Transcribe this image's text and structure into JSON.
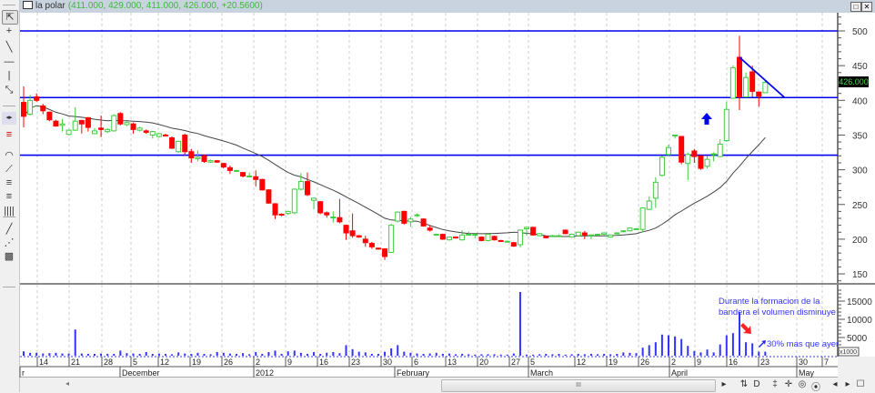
{
  "window": {
    "symbol": "la polar",
    "ohlc_readout": "(411.000, 429.000, 411.000, 426.000, +20.5600)",
    "last_price_label": "426.000"
  },
  "toolbar": {
    "icons": [
      "cursor-arrow",
      "crosshair",
      "trendline",
      "horizontal-line",
      "vertical-line",
      "channel",
      "scroll-arrows",
      "indicators",
      "arcs",
      "fan",
      "fibonacci-p",
      "fibonacci-r",
      "time-zones",
      "line",
      "speed-lines",
      "grid-pattern"
    ]
  },
  "bottom_toolbar": {
    "scroll_thumb_label": "III",
    "buttons": [
      "▸",
      "⇅",
      "D",
      "‡",
      "✛",
      "◎",
      "⦿",
      "◂",
      "▸",
      "☐"
    ]
  },
  "colors": {
    "up": "#3fcc3f",
    "down": "#ff0000",
    "hline": "#0000ee",
    "volume": "#3333ff",
    "ma": "#444444"
  },
  "annotations": {
    "volume_note_line1": "Durante la formacion de la",
    "volume_note_line2": "bandera el volumen disminuye",
    "last_day_note": "30% mas que ayer"
  },
  "chart_data": {
    "type": "candlestick",
    "title": "la polar",
    "price_axis": {
      "ylim": [
        130,
        520
      ],
      "ticks": [
        "500",
        "450",
        "400",
        "350",
        "300",
        "250",
        "200",
        "150"
      ]
    },
    "volume_axis": {
      "ylim": [
        0,
        18000
      ],
      "ticks": [
        "15000",
        "10000",
        "5000"
      ],
      "unit_label": "x1000"
    },
    "x_ticks": [
      "14",
      "21",
      "28",
      "5",
      "12",
      "19",
      "26",
      "2",
      "9",
      "16",
      "23",
      "30",
      "6",
      "13",
      "20",
      "27",
      "5",
      "12",
      "19",
      "26",
      "2",
      "9",
      "16",
      "23",
      "30",
      "7"
    ],
    "x_months": [
      "r",
      "December",
      "2012",
      "February",
      "March",
      "April",
      "May"
    ],
    "horizontal_lines": [
      500,
      404,
      321
    ],
    "flag_trendline": {
      "from": {
        "index": 111,
        "price": 462
      },
      "to": {
        "index": 118,
        "price": 404
      }
    },
    "moving_average": {
      "type": "SMA",
      "period": 20
    },
    "ohlc": [
      [
        397,
        420,
        361,
        377
      ],
      [
        380,
        408,
        378,
        400
      ],
      [
        405,
        410,
        398,
        400
      ],
      [
        392,
        395,
        380,
        385
      ],
      [
        383,
        384,
        370,
        372
      ],
      [
        370,
        372,
        362,
        363
      ],
      [
        364,
        373,
        355,
        366
      ],
      [
        351,
        358,
        350,
        357
      ],
      [
        357,
        390,
        356,
        370
      ],
      [
        371,
        372,
        352,
        366
      ],
      [
        375,
        376,
        355,
        361
      ],
      [
        352,
        360,
        351,
        356
      ],
      [
        360,
        378,
        347,
        358
      ],
      [
        355,
        360,
        353,
        358
      ],
      [
        356,
        380,
        355,
        378
      ],
      [
        381,
        383,
        364,
        366
      ],
      [
        365,
        370,
        363,
        368
      ],
      [
        366,
        368,
        352,
        358
      ],
      [
        357,
        362,
        355,
        360
      ],
      [
        356,
        358,
        352,
        354
      ],
      [
        350,
        356,
        345,
        355
      ],
      [
        348,
        353,
        346,
        352
      ],
      [
        350,
        352,
        348,
        349
      ],
      [
        346,
        348,
        330,
        331
      ],
      [
        326,
        342,
        324,
        341
      ],
      [
        350,
        352,
        320,
        326
      ],
      [
        326,
        330,
        310,
        317
      ],
      [
        316,
        328,
        312,
        318
      ],
      [
        320,
        322,
        310,
        312
      ],
      [
        311,
        315,
        310,
        313
      ],
      [
        313,
        314,
        310,
        311
      ],
      [
        309,
        310,
        302,
        304
      ],
      [
        303,
        306,
        294,
        299
      ],
      [
        298,
        300,
        297,
        299
      ],
      [
        296,
        297,
        289,
        291
      ],
      [
        291,
        296,
        290,
        291
      ],
      [
        290,
        299,
        276,
        286
      ],
      [
        286,
        287,
        270,
        271
      ],
      [
        271,
        272,
        251,
        252
      ],
      [
        251,
        252,
        229,
        235
      ],
      [
        236,
        237,
        233,
        235
      ],
      [
        237,
        241,
        235,
        240
      ],
      [
        238,
        273,
        236,
        272
      ],
      [
        272,
        295,
        270,
        283
      ],
      [
        283,
        296,
        262,
        264
      ],
      [
        256,
        260,
        243,
        259
      ],
      [
        254,
        255,
        236,
        238
      ],
      [
        238,
        240,
        231,
        235
      ],
      [
        232,
        240,
        224,
        232
      ],
      [
        231,
        258,
        223,
        225
      ],
      [
        220,
        221,
        199,
        209
      ],
      [
        212,
        237,
        202,
        205
      ],
      [
        205,
        206,
        202,
        203
      ],
      [
        200,
        205,
        189,
        195
      ],
      [
        194,
        196,
        186,
        189
      ],
      [
        187,
        188,
        185,
        186
      ],
      [
        186,
        187,
        170,
        175
      ],
      [
        181,
        222,
        180,
        220
      ],
      [
        226,
        240,
        224,
        239
      ],
      [
        240,
        241,
        221,
        223
      ],
      [
        225,
        232,
        218,
        229
      ],
      [
        234,
        237,
        232,
        235
      ],
      [
        229,
        230,
        218,
        219
      ],
      [
        216,
        220,
        211,
        213
      ],
      [
        207,
        208,
        205,
        207
      ],
      [
        207,
        208,
        199,
        200
      ],
      [
        199,
        204,
        198,
        203
      ],
      [
        203,
        204,
        201,
        202
      ],
      [
        199,
        213,
        198,
        206
      ],
      [
        206,
        211,
        205,
        207
      ],
      [
        207,
        208,
        201,
        207
      ],
      [
        203,
        204,
        197,
        198
      ],
      [
        198,
        208,
        197,
        207
      ],
      [
        204,
        205,
        198,
        199
      ],
      [
        198,
        199,
        196,
        197
      ],
      [
        197,
        198,
        196,
        197
      ],
      [
        195,
        196,
        189,
        190
      ],
      [
        192,
        214,
        188,
        213
      ],
      [
        215,
        218,
        205,
        217
      ],
      [
        217,
        218,
        205,
        206
      ],
      [
        205,
        209,
        204,
        208
      ],
      [
        204,
        205,
        201,
        202
      ],
      [
        204,
        206,
        203,
        205
      ],
      [
        205,
        207,
        203,
        205
      ],
      [
        213,
        214,
        207,
        208
      ],
      [
        203,
        208,
        202,
        207
      ],
      [
        205,
        211,
        204,
        210
      ],
      [
        209,
        212,
        200,
        206
      ],
      [
        206,
        207,
        200,
        206
      ],
      [
        206,
        208,
        205,
        207
      ],
      [
        207,
        210,
        206,
        209
      ],
      [
        203,
        207,
        202,
        206
      ],
      [
        208,
        210,
        207,
        209
      ],
      [
        211,
        213,
        210,
        212
      ],
      [
        212,
        217,
        211,
        216
      ],
      [
        215,
        216,
        214,
        215
      ],
      [
        214,
        246,
        210,
        245
      ],
      [
        243,
        262,
        242,
        255
      ],
      [
        259,
        289,
        245,
        282
      ],
      [
        292,
        320,
        290,
        318
      ],
      [
        322,
        336,
        320,
        332
      ],
      [
        349,
        350,
        345,
        350
      ],
      [
        348,
        348,
        308,
        311
      ],
      [
        309,
        325,
        285,
        322
      ],
      [
        327,
        330,
        310,
        319
      ],
      [
        320,
        321,
        300,
        302
      ],
      [
        305,
        320,
        302,
        315
      ],
      [
        322,
        325,
        312,
        323
      ],
      [
        319,
        344,
        318,
        337
      ],
      [
        342,
        398,
        340,
        387
      ],
      [
        403,
        450,
        402,
        447
      ],
      [
        462,
        493,
        386,
        405
      ],
      [
        405,
        440,
        404,
        433
      ],
      [
        441,
        450,
        405,
        413
      ],
      [
        412,
        412,
        391,
        406
      ],
      [
        411,
        429,
        411,
        426
      ]
    ],
    "volume": [
      1200,
      800,
      800,
      600,
      700,
      800,
      600,
      600,
      7200,
      600,
      500,
      500,
      600,
      500,
      500,
      1400,
      700,
      600,
      500,
      1000,
      500,
      600,
      500,
      400,
      900,
      600,
      500,
      800,
      500,
      400,
      1000,
      800,
      600,
      500,
      700,
      400,
      1000,
      500,
      1000,
      1400,
      500,
      1200,
      1400,
      800,
      500,
      1000,
      500,
      800,
      1000,
      700,
      2900,
      1800,
      1100,
      900,
      500,
      500,
      1100,
      2000,
      2900,
      1100,
      800,
      600,
      500,
      600,
      800,
      500,
      600,
      400,
      500,
      400,
      300,
      400,
      400,
      400,
      300,
      300,
      600,
      17500,
      300,
      300,
      400,
      500,
      400,
      500,
      300,
      400,
      500,
      400,
      500,
      400,
      500,
      400,
      500,
      900,
      800,
      700,
      2200,
      2900,
      3700,
      5800,
      5600,
      5300,
      4600,
      2700,
      1300,
      900,
      1700,
      900,
      3100,
      5600,
      6200,
      12000,
      3700,
      3400,
      1100,
      1100
    ]
  }
}
